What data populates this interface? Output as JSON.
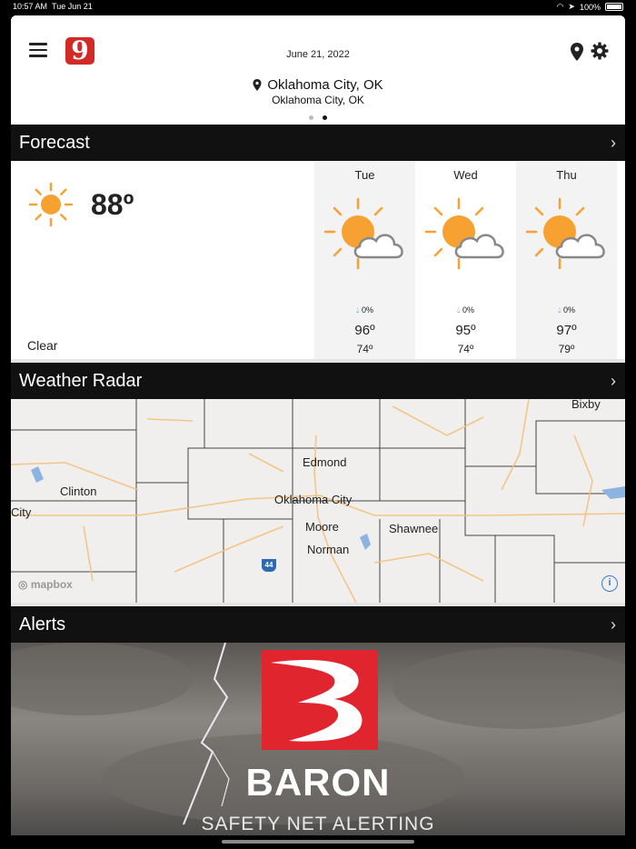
{
  "status": {
    "time": "10:57 AM",
    "date": "Tue Jun 21",
    "battery": "100%"
  },
  "header": {
    "date": "June 21, 2022",
    "logo_text": "9",
    "location_main": "Oklahoma City, OK",
    "location_sub": "Oklahoma City, OK"
  },
  "forecast": {
    "title": "Forecast",
    "current_temp": "88º",
    "current_condition": "Clear",
    "days": [
      {
        "name": "Tue",
        "precip": "0%",
        "hi": "96º",
        "lo": "74º"
      },
      {
        "name": "Wed",
        "precip": "0%",
        "hi": "95º",
        "lo": "74º"
      },
      {
        "name": "Thu",
        "precip": "0%",
        "hi": "97º",
        "lo": "79º"
      }
    ]
  },
  "radar": {
    "title": "Weather Radar",
    "cities": {
      "bixby": "Bixby",
      "edmond": "Edmond",
      "clinton": "Clinton",
      "okc": "Oklahoma City",
      "city": "City",
      "moore": "Moore",
      "shawnee": "Shawnee",
      "norman": "Norman"
    },
    "highway": "44",
    "attribution": "mapbox"
  },
  "alerts": {
    "title": "Alerts",
    "brand": "BARON",
    "subtitle": "SAFETY NET ALERTING"
  },
  "colors": {
    "bar": "#111111",
    "sun": "#f7a132",
    "brand_red": "#e1252f",
    "precip_drop": "#2f7ee6"
  }
}
